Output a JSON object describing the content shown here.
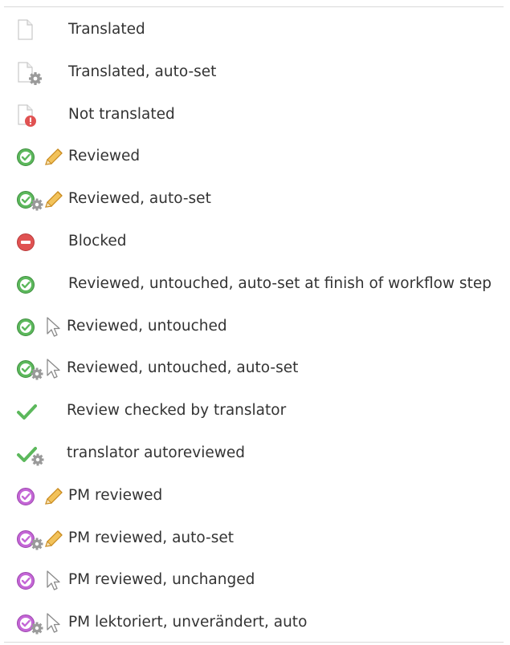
{
  "legend": {
    "items": [
      {
        "label": "Translated",
        "icons": [
          "document-icon"
        ]
      },
      {
        "label": "Translated, auto-set",
        "icons": [
          "document-gear-icon"
        ]
      },
      {
        "label": "Not translated",
        "icons": [
          "document-warning-icon"
        ]
      },
      {
        "label": "Reviewed",
        "icons": [
          "green-check-circle-icon",
          "pencil-icon"
        ]
      },
      {
        "label": "Reviewed, auto-set",
        "icons": [
          "green-check-circle-gear-icon",
          "pencil-icon"
        ]
      },
      {
        "label": "Blocked",
        "icons": [
          "red-minus-circle-icon"
        ]
      },
      {
        "label": "Reviewed, untouched, auto-set at finish of workflow step",
        "icons": [
          "green-check-circle-icon"
        ]
      },
      {
        "label": "Reviewed, untouched",
        "icons": [
          "green-check-circle-icon",
          "cursor-arrow-icon"
        ]
      },
      {
        "label": "Reviewed, untouched, auto-set",
        "icons": [
          "green-check-circle-gear-icon",
          "cursor-arrow-icon"
        ]
      },
      {
        "label": "Review checked by translator",
        "icons": [
          "green-checkmark-icon"
        ]
      },
      {
        "label": "translator autoreviewed",
        "icons": [
          "green-checkmark-gear-icon"
        ]
      },
      {
        "label": "PM reviewed",
        "icons": [
          "purple-check-circle-icon",
          "pencil-icon"
        ]
      },
      {
        "label": "PM reviewed, auto-set",
        "icons": [
          "purple-check-circle-gear-icon",
          "pencil-icon"
        ]
      },
      {
        "label": "PM reviewed, unchanged",
        "icons": [
          "purple-check-circle-icon",
          "cursor-arrow-icon"
        ]
      },
      {
        "label": "PM lektoriert, unverändert, auto",
        "icons": [
          "purple-check-circle-gear-icon",
          "cursor-arrow-icon"
        ]
      }
    ]
  },
  "colors": {
    "green": "#5cb85c",
    "green_dark": "#3f8f3f",
    "red": "#e05252",
    "purple": "#c466d6",
    "pencil": "#e8a630",
    "gear": "#9a9a9a",
    "text": "#333333"
  }
}
